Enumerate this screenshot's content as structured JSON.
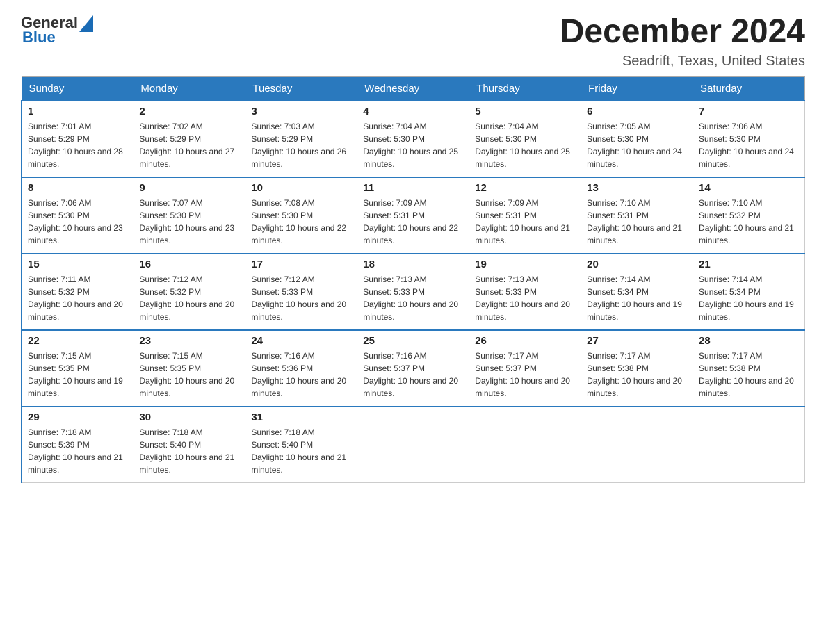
{
  "header": {
    "logo_general": "General",
    "logo_blue": "Blue",
    "month_title": "December 2024",
    "location": "Seadrift, Texas, United States"
  },
  "days_of_week": [
    "Sunday",
    "Monday",
    "Tuesday",
    "Wednesday",
    "Thursday",
    "Friday",
    "Saturday"
  ],
  "weeks": [
    [
      {
        "day": "1",
        "sunrise": "7:01 AM",
        "sunset": "5:29 PM",
        "daylight": "10 hours and 28 minutes."
      },
      {
        "day": "2",
        "sunrise": "7:02 AM",
        "sunset": "5:29 PM",
        "daylight": "10 hours and 27 minutes."
      },
      {
        "day": "3",
        "sunrise": "7:03 AM",
        "sunset": "5:29 PM",
        "daylight": "10 hours and 26 minutes."
      },
      {
        "day": "4",
        "sunrise": "7:04 AM",
        "sunset": "5:30 PM",
        "daylight": "10 hours and 25 minutes."
      },
      {
        "day": "5",
        "sunrise": "7:04 AM",
        "sunset": "5:30 PM",
        "daylight": "10 hours and 25 minutes."
      },
      {
        "day": "6",
        "sunrise": "7:05 AM",
        "sunset": "5:30 PM",
        "daylight": "10 hours and 24 minutes."
      },
      {
        "day": "7",
        "sunrise": "7:06 AM",
        "sunset": "5:30 PM",
        "daylight": "10 hours and 24 minutes."
      }
    ],
    [
      {
        "day": "8",
        "sunrise": "7:06 AM",
        "sunset": "5:30 PM",
        "daylight": "10 hours and 23 minutes."
      },
      {
        "day": "9",
        "sunrise": "7:07 AM",
        "sunset": "5:30 PM",
        "daylight": "10 hours and 23 minutes."
      },
      {
        "day": "10",
        "sunrise": "7:08 AM",
        "sunset": "5:30 PM",
        "daylight": "10 hours and 22 minutes."
      },
      {
        "day": "11",
        "sunrise": "7:09 AM",
        "sunset": "5:31 PM",
        "daylight": "10 hours and 22 minutes."
      },
      {
        "day": "12",
        "sunrise": "7:09 AM",
        "sunset": "5:31 PM",
        "daylight": "10 hours and 21 minutes."
      },
      {
        "day": "13",
        "sunrise": "7:10 AM",
        "sunset": "5:31 PM",
        "daylight": "10 hours and 21 minutes."
      },
      {
        "day": "14",
        "sunrise": "7:10 AM",
        "sunset": "5:32 PM",
        "daylight": "10 hours and 21 minutes."
      }
    ],
    [
      {
        "day": "15",
        "sunrise": "7:11 AM",
        "sunset": "5:32 PM",
        "daylight": "10 hours and 20 minutes."
      },
      {
        "day": "16",
        "sunrise": "7:12 AM",
        "sunset": "5:32 PM",
        "daylight": "10 hours and 20 minutes."
      },
      {
        "day": "17",
        "sunrise": "7:12 AM",
        "sunset": "5:33 PM",
        "daylight": "10 hours and 20 minutes."
      },
      {
        "day": "18",
        "sunrise": "7:13 AM",
        "sunset": "5:33 PM",
        "daylight": "10 hours and 20 minutes."
      },
      {
        "day": "19",
        "sunrise": "7:13 AM",
        "sunset": "5:33 PM",
        "daylight": "10 hours and 20 minutes."
      },
      {
        "day": "20",
        "sunrise": "7:14 AM",
        "sunset": "5:34 PM",
        "daylight": "10 hours and 19 minutes."
      },
      {
        "day": "21",
        "sunrise": "7:14 AM",
        "sunset": "5:34 PM",
        "daylight": "10 hours and 19 minutes."
      }
    ],
    [
      {
        "day": "22",
        "sunrise": "7:15 AM",
        "sunset": "5:35 PM",
        "daylight": "10 hours and 19 minutes."
      },
      {
        "day": "23",
        "sunrise": "7:15 AM",
        "sunset": "5:35 PM",
        "daylight": "10 hours and 20 minutes."
      },
      {
        "day": "24",
        "sunrise": "7:16 AM",
        "sunset": "5:36 PM",
        "daylight": "10 hours and 20 minutes."
      },
      {
        "day": "25",
        "sunrise": "7:16 AM",
        "sunset": "5:37 PM",
        "daylight": "10 hours and 20 minutes."
      },
      {
        "day": "26",
        "sunrise": "7:17 AM",
        "sunset": "5:37 PM",
        "daylight": "10 hours and 20 minutes."
      },
      {
        "day": "27",
        "sunrise": "7:17 AM",
        "sunset": "5:38 PM",
        "daylight": "10 hours and 20 minutes."
      },
      {
        "day": "28",
        "sunrise": "7:17 AM",
        "sunset": "5:38 PM",
        "daylight": "10 hours and 20 minutes."
      }
    ],
    [
      {
        "day": "29",
        "sunrise": "7:18 AM",
        "sunset": "5:39 PM",
        "daylight": "10 hours and 21 minutes."
      },
      {
        "day": "30",
        "sunrise": "7:18 AM",
        "sunset": "5:40 PM",
        "daylight": "10 hours and 21 minutes."
      },
      {
        "day": "31",
        "sunrise": "7:18 AM",
        "sunset": "5:40 PM",
        "daylight": "10 hours and 21 minutes."
      },
      null,
      null,
      null,
      null
    ]
  ]
}
